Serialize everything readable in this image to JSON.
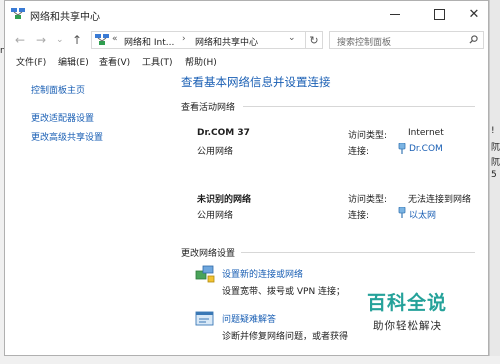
{
  "window": {
    "title": "网络和共享中心",
    "controls": {
      "minimize": "—",
      "maximize": "☐",
      "close": "✕"
    }
  },
  "address": {
    "crumb_overflow": "«",
    "crumb_1": "网络和 Int...",
    "crumb_sep": "›",
    "crumb_2": "网络和共享中心",
    "dropdown": "⌄",
    "refresh": "↻",
    "search_placeholder": "搜索控制面板"
  },
  "menu": [
    {
      "label": "文件(F)"
    },
    {
      "label": "编辑(E)"
    },
    {
      "label": "查看(V)"
    },
    {
      "label": "工具(T)"
    },
    {
      "label": "帮助(H)"
    }
  ],
  "sidebar": {
    "home": "控制面板主页",
    "adapter_settings": "更改适配器设置",
    "advanced_sharing": "更改高级共享设置"
  },
  "main": {
    "heading": "查看基本网络信息并设置连接",
    "active_networks_title": "查看活动网络",
    "networks": [
      {
        "name": "Dr.COM  37",
        "category": "公用网络",
        "access_label": "访问类型:",
        "access_value": "Internet",
        "connection_label": "连接:",
        "connection_value": "Dr.COM"
      },
      {
        "name": "未识别的网络",
        "category": "公用网络",
        "access_label": "访问类型:",
        "access_value": "无法连接到网络",
        "connection_label": "连接:",
        "connection_value": "以太网"
      }
    ],
    "change_settings_title": "更改网络设置",
    "tasks": [
      {
        "link": "设置新的连接或网络",
        "desc": "设置宽带、拨号或 VPN 连接；"
      },
      {
        "link": "问题疑难解答",
        "desc": "诊断并修复网络问题，或者获得"
      }
    ]
  },
  "background": {
    "left_text": "nt",
    "right_chars": [
      "!",
      "阢",
      "阢",
      "5"
    ]
  },
  "watermark": {
    "title": "百科全说",
    "subtitle": "助你轻松解决"
  },
  "colors": {
    "link": "#1a5fb4",
    "watermark": "#25a29a"
  }
}
